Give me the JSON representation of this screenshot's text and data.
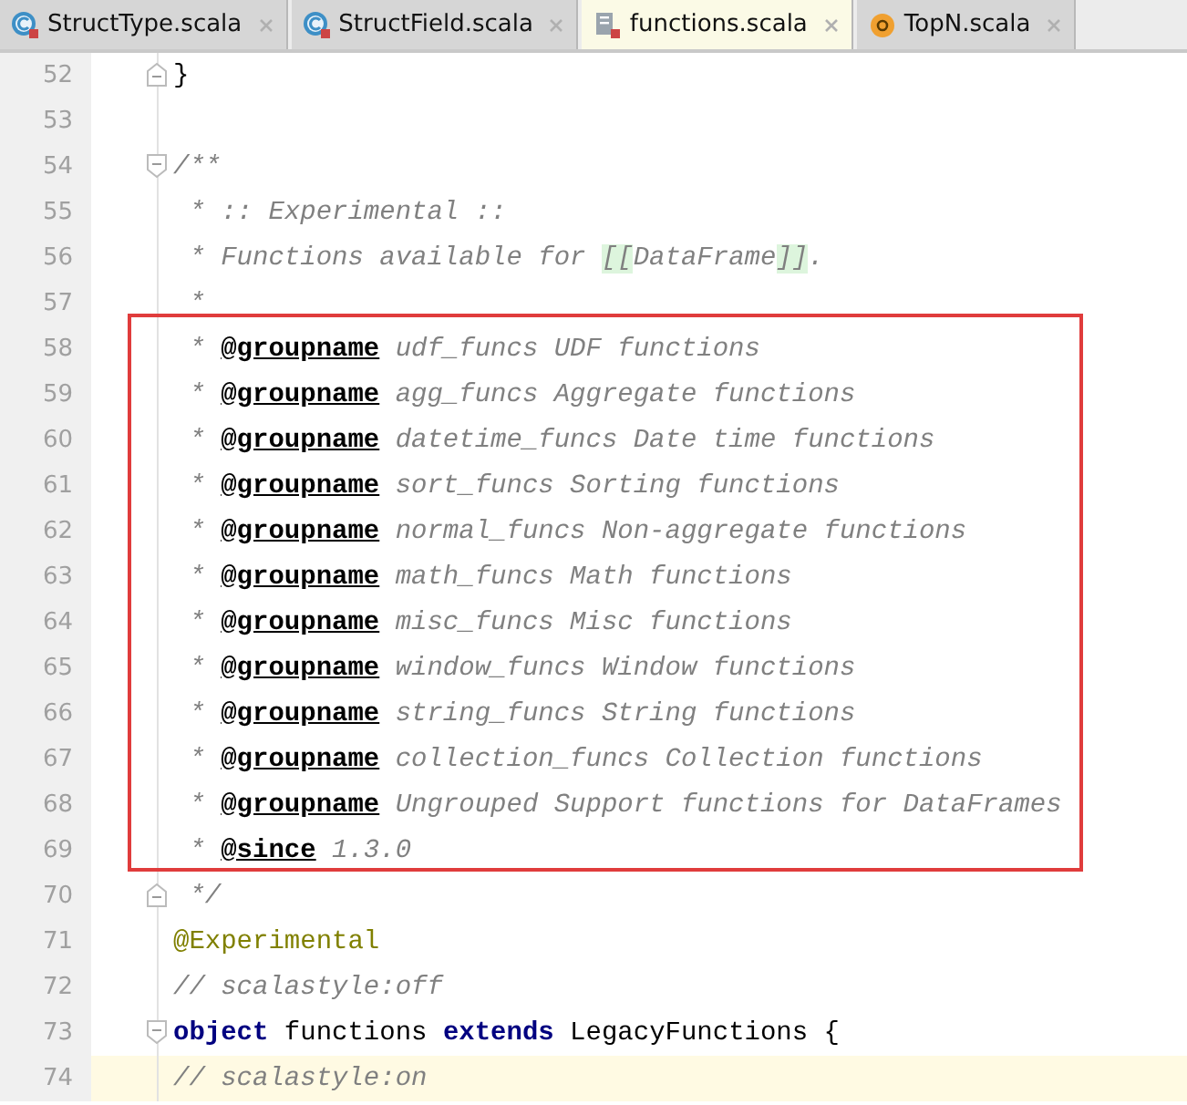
{
  "tabs": [
    {
      "label": "StructType.scala",
      "kind": "class",
      "selected": false
    },
    {
      "label": "StructField.scala",
      "kind": "class",
      "selected": false
    },
    {
      "label": "functions.scala",
      "kind": "file",
      "selected": true
    },
    {
      "label": "TopN.scala",
      "kind": "object",
      "selected": false
    }
  ],
  "blocks": [
    {
      "framed": false,
      "lines": [
        {
          "number": "52",
          "fold_end": true,
          "current": false,
          "segments": [
            {
              "kind": "plain",
              "text": "}"
            }
          ]
        },
        {
          "number": "53",
          "current": false
        },
        {
          "number": "54",
          "fold_start": true,
          "current": false,
          "segments": [
            {
              "kind": "comment",
              "text": "/**"
            }
          ]
        },
        {
          "number": "55",
          "current": false,
          "segments": [
            {
              "kind": "comment",
              "text": " * :: Experimental ::"
            }
          ]
        },
        {
          "number": "56",
          "current": false,
          "segments": [
            {
              "kind": "comment",
              "text": " * Functions available for "
            },
            {
              "kind": "link",
              "text": "[["
            },
            {
              "kind": "comment",
              "text": "DataFrame"
            },
            {
              "kind": "link",
              "text": "]]"
            },
            {
              "kind": "comment",
              "text": "."
            }
          ]
        },
        {
          "number": "57",
          "current": false,
          "segments": [
            {
              "kind": "comment",
              "text": " *"
            }
          ]
        }
      ]
    },
    {
      "framed": true,
      "lines": [
        {
          "number": "58",
          "current": false,
          "segments": [
            {
              "kind": "comment",
              "text": " * "
            },
            {
              "kind": "tag",
              "text": "@groupname"
            },
            {
              "kind": "comment",
              "text": " udf_funcs UDF functions"
            }
          ]
        },
        {
          "number": "59",
          "current": false,
          "segments": [
            {
              "kind": "comment",
              "text": " * "
            },
            {
              "kind": "tag",
              "text": "@groupname"
            },
            {
              "kind": "comment",
              "text": " agg_funcs Aggregate functions"
            }
          ]
        },
        {
          "number": "60",
          "current": false,
          "segments": [
            {
              "kind": "comment",
              "text": " * "
            },
            {
              "kind": "tag",
              "text": "@groupname"
            },
            {
              "kind": "comment",
              "text": " datetime_funcs Date time functions"
            }
          ]
        },
        {
          "number": "61",
          "current": false,
          "segments": [
            {
              "kind": "comment",
              "text": " * "
            },
            {
              "kind": "tag",
              "text": "@groupname"
            },
            {
              "kind": "comment",
              "text": " sort_funcs Sorting functions"
            }
          ]
        },
        {
          "number": "62",
          "current": false,
          "segments": [
            {
              "kind": "comment",
              "text": " * "
            },
            {
              "kind": "tag",
              "text": "@groupname"
            },
            {
              "kind": "comment",
              "text": " normal_funcs Non-aggregate functions"
            }
          ]
        },
        {
          "number": "63",
          "current": false,
          "segments": [
            {
              "kind": "comment",
              "text": " * "
            },
            {
              "kind": "tag",
              "text": "@groupname"
            },
            {
              "kind": "comment",
              "text": " math_funcs Math functions"
            }
          ]
        },
        {
          "number": "64",
          "current": false,
          "segments": [
            {
              "kind": "comment",
              "text": " * "
            },
            {
              "kind": "tag",
              "text": "@groupname"
            },
            {
              "kind": "comment",
              "text": " misc_funcs Misc functions"
            }
          ]
        },
        {
          "number": "65",
          "current": false,
          "segments": [
            {
              "kind": "comment",
              "text": " * "
            },
            {
              "kind": "tag",
              "text": "@groupname"
            },
            {
              "kind": "comment",
              "text": " window_funcs Window functions"
            }
          ]
        },
        {
          "number": "66",
          "current": false,
          "segments": [
            {
              "kind": "comment",
              "text": " * "
            },
            {
              "kind": "tag",
              "text": "@groupname"
            },
            {
              "kind": "comment",
              "text": " string_funcs String functions"
            }
          ]
        },
        {
          "number": "67",
          "current": false,
          "segments": [
            {
              "kind": "comment",
              "text": " * "
            },
            {
              "kind": "tag",
              "text": "@groupname"
            },
            {
              "kind": "comment",
              "text": " collection_funcs Collection functions"
            }
          ]
        },
        {
          "number": "68",
          "current": false,
          "segments": [
            {
              "kind": "comment",
              "text": " * "
            },
            {
              "kind": "tag",
              "text": "@groupname"
            },
            {
              "kind": "comment",
              "text": " Ungrouped Support functions for DataFrames"
            }
          ]
        },
        {
          "number": "69",
          "current": false,
          "segments": [
            {
              "kind": "comment",
              "text": " * "
            },
            {
              "kind": "tag",
              "text": "@since"
            },
            {
              "kind": "comment",
              "text": " 1.3.0"
            }
          ]
        }
      ]
    },
    {
      "framed": false,
      "lines": [
        {
          "number": "70",
          "fold_end": true,
          "current": false,
          "segments": [
            {
              "kind": "comment",
              "text": " */"
            }
          ]
        },
        {
          "number": "71",
          "current": false,
          "segments": [
            {
              "kind": "annotation",
              "text": "@Experimental"
            }
          ]
        },
        {
          "number": "72",
          "current": false,
          "segments": [
            {
              "kind": "comment",
              "text": "// scalastyle:off"
            }
          ]
        },
        {
          "number": "73",
          "fold_start": true,
          "current": false,
          "segments": [
            {
              "kind": "keyword",
              "text": "object"
            },
            {
              "kind": "plain",
              "text": " functions "
            },
            {
              "kind": "keyword",
              "text": "extends"
            },
            {
              "kind": "plain",
              "text": " LegacyFunctions {"
            }
          ]
        },
        {
          "number": "74",
          "current": true,
          "segments": [
            {
              "kind": "comment",
              "text": "// scalastyle:on"
            }
          ]
        }
      ]
    }
  ]
}
